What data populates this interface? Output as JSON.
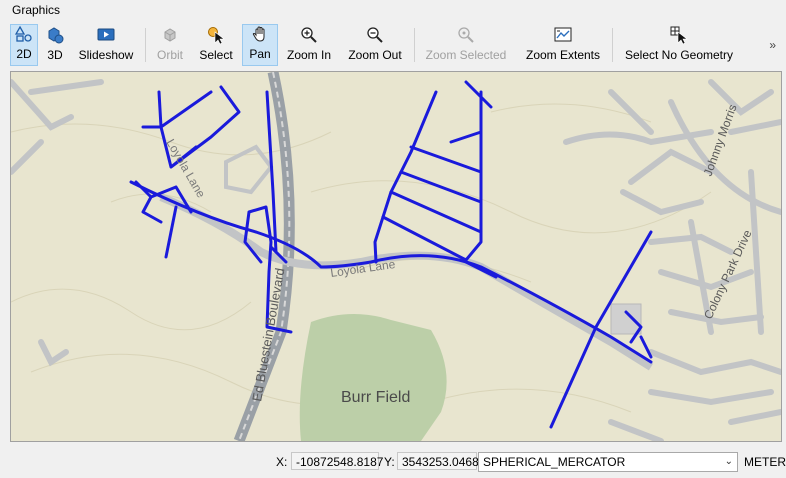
{
  "panel": {
    "title": "Graphics"
  },
  "toolbar": {
    "buttons": [
      {
        "label": "2D",
        "icon": "2d-shapes-icon",
        "active": true,
        "enabled": true
      },
      {
        "label": "3D",
        "icon": "3d-shapes-icon",
        "active": false,
        "enabled": true
      },
      {
        "label": "Slideshow",
        "icon": "slideshow-icon",
        "active": false,
        "enabled": true
      },
      {
        "label": "Orbit",
        "icon": "orbit-icon",
        "active": false,
        "enabled": false
      },
      {
        "label": "Select",
        "icon": "select-cursor-icon",
        "active": false,
        "enabled": true
      },
      {
        "label": "Pan",
        "icon": "hand-pan-icon",
        "active": true,
        "enabled": true
      },
      {
        "label": "Zoom In",
        "icon": "zoom-in-icon",
        "active": false,
        "enabled": true
      },
      {
        "label": "Zoom Out",
        "icon": "zoom-out-icon",
        "active": false,
        "enabled": true
      },
      {
        "label": "Zoom Selected",
        "icon": "zoom-selected-icon",
        "active": false,
        "enabled": false
      },
      {
        "label": "Zoom Extents",
        "icon": "zoom-extents-icon",
        "active": false,
        "enabled": true
      },
      {
        "label": "Select No Geometry",
        "icon": "select-no-geometry-icon",
        "active": false,
        "enabled": true
      }
    ],
    "overflow": "»"
  },
  "map": {
    "labels": {
      "loyola_lane": "Loyola Lane",
      "loyola_lane_west": "Loyola Lane",
      "blvd": "Ed Bluestein Boulevard",
      "burr_field": "Burr Field",
      "johnny_morris": "Johnny Morris",
      "colony_park": "Colony Park Drive"
    },
    "colors": {
      "background": "#e8e5cf",
      "roads": "#c2c4c6",
      "network": "#1a1adb",
      "park": "#bccfa8"
    }
  },
  "status": {
    "x_label": "X:",
    "x_value": "-10872548.8187",
    "y_label": "Y:",
    "y_value": "3543253.0468",
    "projection": "SPHERICAL_MERCATOR",
    "units": "METER"
  }
}
